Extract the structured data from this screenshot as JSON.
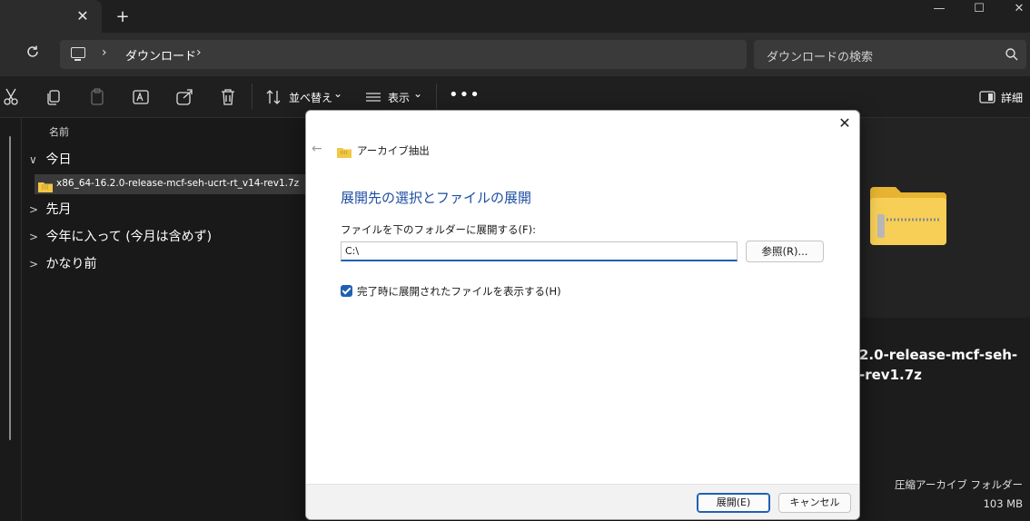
{
  "titlebar": {
    "tab_close": "✕",
    "new_tab": "+",
    "minimize": "—",
    "maximize": "☐",
    "close": "✕"
  },
  "address": {
    "refresh_icon": "C",
    "crumb_sep": "›",
    "crumb": "ダウンロード",
    "search_placeholder": "ダウンロードの検索"
  },
  "toolbar": {
    "sort_label": "並べ替え",
    "view_label": "表示",
    "more": "•••",
    "details_label": "詳細",
    "caret": "⌄"
  },
  "filelist": {
    "column_name": "名前",
    "groups": [
      {
        "chev": "∨",
        "label": "今日"
      },
      {
        "chev": ">",
        "label": "先月"
      },
      {
        "chev": ">",
        "label": "今年に入って (今月は含めず)"
      },
      {
        "chev": ">",
        "label": "かなり前"
      }
    ],
    "selected_file": "x86_64-16.2.0-release-mcf-seh-ucrt-rt_v14-rev1.7z"
  },
  "preview": {
    "name": "2.0-release-mcf-seh-\n-rev1.7z",
    "type": "圧縮アーカイブ フォルダー",
    "size": "103 MB"
  },
  "dialog": {
    "close": "✕",
    "back": "←",
    "title": "アーカイブ抽出",
    "heading": "展開先の選択とファイルの展開",
    "path_label": "ファイルを下のフォルダーに展開する(F):",
    "path_value": "C:\\",
    "browse_button": "参照(R)...",
    "show_files_label": "完了時に展開されたファイルを表示する(H)",
    "show_files_checked": true,
    "extract_button": "展開(E)",
    "cancel_button": "キャンセル"
  },
  "colors": {
    "accent": "#1f5fb5",
    "heading": "#1f4fa3",
    "zip_yellow": "#f2c744"
  }
}
